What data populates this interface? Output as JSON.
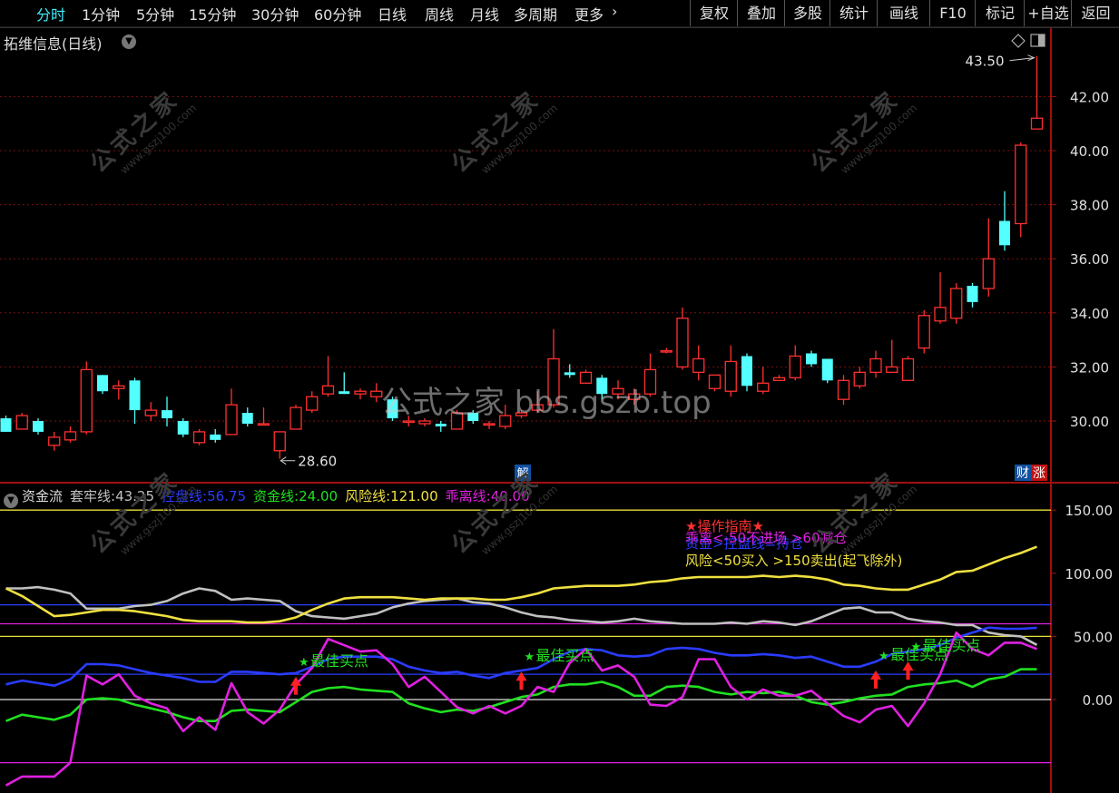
{
  "toolbar": {
    "periods": [
      "分时",
      "1分钟",
      "5分钟",
      "15分钟",
      "30分钟",
      "60分钟",
      "日线",
      "周线",
      "月线",
      "多周期",
      "更多"
    ],
    "active_period": "分时",
    "right_buttons": [
      "复权",
      "叠加",
      "多股",
      "统计",
      "画线",
      "F10",
      "标记",
      "+自选",
      "返回"
    ]
  },
  "stock": {
    "title": "拓维信息(日线)"
  },
  "watermark": {
    "center": "公式之家 bbs.gszb.top",
    "corner_cn": "公式之家",
    "corner_url": "www.gszj100.com"
  },
  "indicator": {
    "name": "资金流",
    "values": [
      {
        "label": "套牢线:",
        "value": "43.25",
        "color": "#c0c0c0"
      },
      {
        "label": "控盘线:",
        "value": "56.75",
        "color": "#2a3cff"
      },
      {
        "label": "资金线:",
        "value": "24.00",
        "color": "#20e020"
      },
      {
        "label": "风险线:",
        "value": "121.00",
        "color": "#f0e040"
      },
      {
        "label": "乖离线:",
        "value": "40.00",
        "color": "#e020e0"
      }
    ]
  },
  "annotations": {
    "guide_title": "★操作指南★",
    "guide_lines": [
      "乖离<-50不进场 >60减仓",
      "风险<50买入 >150卖出(起飞除外)"
    ],
    "guide_overlap": "资金>控盘线=持仓",
    "buy_label": "最佳买点",
    "max_label": "43.50",
    "min_label": "28.60",
    "badge_cw": "财",
    "badge_zhang": "涨",
    "badge_jie": "解"
  },
  "colors": {
    "up": "#ff3030",
    "down": "#54ffff",
    "grid": "#7a1010",
    "axis": "#a01010"
  },
  "chart_data": [
    {
      "type": "candlestick",
      "title": "拓维信息(日线)",
      "price_ticks": [
        "30.00",
        "32.00",
        "34.00",
        "36.00",
        "38.00",
        "40.00",
        "42.00"
      ],
      "ylim": [
        28.0,
        44.0
      ],
      "max_marker": 43.5,
      "min_marker": 28.6,
      "candles": [
        [
          30.1,
          29.6,
          30.2,
          29.6
        ],
        [
          29.7,
          30.2,
          30.3,
          29.7
        ],
        [
          30.0,
          29.6,
          30.1,
          29.5
        ],
        [
          29.1,
          29.4,
          29.6,
          28.9
        ],
        [
          29.3,
          29.6,
          29.8,
          29.2
        ],
        [
          29.6,
          31.9,
          32.2,
          29.5
        ],
        [
          31.7,
          31.1,
          31.7,
          31.0
        ],
        [
          31.2,
          31.3,
          31.5,
          30.8
        ],
        [
          31.5,
          30.4,
          31.6,
          29.9
        ],
        [
          30.2,
          30.4,
          30.7,
          30.0
        ],
        [
          30.4,
          30.1,
          30.9,
          29.8
        ],
        [
          30.0,
          29.5,
          30.1,
          29.4
        ],
        [
          29.2,
          29.6,
          29.7,
          29.1
        ],
        [
          29.5,
          29.3,
          29.7,
          29.2
        ],
        [
          29.5,
          30.6,
          31.2,
          29.5
        ],
        [
          30.3,
          29.9,
          30.5,
          29.8
        ],
        [
          29.9,
          29.9,
          30.5,
          29.9
        ],
        [
          28.9,
          29.6,
          29.6,
          28.6
        ],
        [
          29.7,
          30.5,
          30.6,
          29.7
        ],
        [
          30.4,
          30.9,
          31.1,
          30.3
        ],
        [
          31.0,
          31.3,
          32.4,
          30.9
        ],
        [
          31.1,
          31.0,
          31.8,
          31.0
        ],
        [
          31.0,
          31.1,
          31.2,
          30.8
        ],
        [
          30.9,
          31.1,
          31.4,
          30.7
        ],
        [
          30.8,
          30.1,
          30.9,
          30.0
        ],
        [
          30.0,
          30.0,
          30.2,
          29.8
        ],
        [
          29.9,
          30.0,
          30.1,
          29.8
        ],
        [
          29.9,
          29.8,
          30.0,
          29.6
        ],
        [
          29.7,
          30.3,
          30.4,
          29.7
        ],
        [
          30.3,
          30.0,
          30.4,
          29.9
        ],
        [
          29.9,
          29.9,
          30.0,
          29.7
        ],
        [
          29.8,
          30.2,
          30.6,
          29.7
        ],
        [
          30.2,
          30.3,
          30.4,
          30.1
        ],
        [
          30.4,
          30.6,
          31.1,
          30.3
        ],
        [
          30.6,
          32.3,
          33.4,
          30.5
        ],
        [
          31.8,
          31.7,
          32.1,
          31.6
        ],
        [
          31.4,
          31.8,
          31.9,
          31.4
        ],
        [
          31.6,
          31.0,
          31.7,
          30.8
        ],
        [
          31.0,
          31.2,
          31.5,
          30.8
        ],
        [
          30.8,
          31.0,
          31.2,
          30.6
        ],
        [
          31.0,
          31.9,
          32.5,
          30.9
        ],
        [
          32.6,
          32.6,
          32.7,
          32.5
        ],
        [
          32.0,
          33.8,
          34.2,
          31.9
        ],
        [
          31.8,
          32.3,
          32.8,
          31.5
        ],
        [
          31.2,
          31.7,
          31.7,
          31.1
        ],
        [
          31.1,
          32.2,
          32.8,
          30.9
        ],
        [
          32.4,
          31.3,
          32.5,
          31.1
        ],
        [
          31.1,
          31.4,
          32.0,
          31.0
        ],
        [
          31.5,
          31.6,
          31.7,
          31.5
        ],
        [
          31.6,
          32.4,
          32.8,
          31.5
        ],
        [
          32.5,
          32.1,
          32.6,
          32.0
        ],
        [
          32.3,
          31.5,
          32.3,
          31.4
        ],
        [
          30.8,
          31.5,
          31.7,
          30.6
        ],
        [
          31.3,
          31.8,
          32.0,
          31.2
        ],
        [
          31.8,
          32.3,
          32.6,
          31.6
        ],
        [
          31.8,
          32.0,
          33.0,
          31.8
        ],
        [
          31.5,
          32.3,
          32.4,
          31.5
        ],
        [
          32.7,
          33.9,
          34.1,
          32.5
        ],
        [
          33.7,
          34.2,
          35.5,
          33.6
        ],
        [
          33.8,
          34.9,
          35.1,
          33.6
        ],
        [
          35.0,
          34.4,
          35.1,
          34.2
        ],
        [
          34.9,
          36.0,
          37.5,
          34.6
        ],
        [
          37.4,
          36.5,
          38.5,
          36.3
        ],
        [
          37.3,
          40.2,
          40.3,
          36.8
        ],
        [
          40.8,
          41.2,
          43.5,
          40.9
        ]
      ]
    },
    {
      "type": "line",
      "title": "资金流",
      "yticks": [
        "0.00",
        "50.00",
        "100.00",
        "150.00"
      ],
      "ylim": [
        -72,
        168
      ],
      "hlines": [
        {
          "value": 150,
          "color": "#e8e03a"
        },
        {
          "value": 75,
          "color": "#2a3cff"
        },
        {
          "value": 60,
          "color": "#e020e0"
        },
        {
          "value": 50,
          "color": "#e8e03a"
        },
        {
          "value": 20,
          "color": "#2a3cff"
        },
        {
          "value": 0,
          "color": "#e0e0e0"
        },
        {
          "value": -50,
          "color": "#e020e0"
        }
      ],
      "series": [
        {
          "name": "套牢线",
          "color": "#c0c0c0",
          "values": [
            88,
            88,
            89,
            87,
            84,
            72,
            72,
            72,
            74,
            75,
            78,
            84,
            88,
            86,
            79,
            80,
            79,
            78,
            70,
            66,
            65,
            64,
            66,
            68,
            73,
            76,
            78,
            79,
            80,
            77,
            76,
            73,
            69,
            66,
            65,
            63,
            62,
            61,
            62,
            64,
            62,
            61,
            60,
            60,
            60,
            61,
            60,
            62,
            61,
            59,
            62,
            67,
            72,
            73,
            69,
            69,
            64,
            62,
            61,
            59,
            59,
            53,
            51,
            50,
            43.25
          ]
        },
        {
          "name": "控盘线",
          "color": "#2a3cff",
          "values": [
            12,
            15,
            13,
            11,
            16,
            28,
            28,
            27,
            24,
            21,
            19,
            17,
            14,
            14,
            22,
            22,
            21,
            20,
            21,
            26,
            32,
            34,
            34,
            34,
            32,
            26,
            23,
            21,
            22,
            19,
            17,
            21,
            23,
            25,
            32,
            38,
            40,
            39,
            35,
            34,
            35,
            40,
            41,
            40,
            37,
            35,
            35,
            36,
            35,
            33,
            34,
            30,
            26,
            26,
            30,
            36,
            38,
            40,
            43,
            49,
            53,
            57,
            56,
            56,
            56.75
          ]
        },
        {
          "name": "资金线",
          "color": "#20e020",
          "values": [
            -17,
            -12,
            -14,
            -16,
            -12,
            0,
            1,
            0,
            -4,
            -7,
            -10,
            -14,
            -17,
            -17,
            -9,
            -8,
            -9,
            -10,
            -2,
            6,
            9,
            10,
            8,
            7,
            6,
            -3,
            -7,
            -10,
            -8,
            -9,
            -6,
            -2,
            2,
            4,
            10,
            12,
            12,
            14,
            10,
            3,
            3,
            10,
            11,
            10,
            6,
            4,
            6,
            5,
            6,
            3,
            -2,
            -4,
            -2,
            1,
            3,
            4,
            10,
            12,
            13,
            15,
            10,
            16,
            18,
            24,
            24.0
          ]
        },
        {
          "name": "风险线",
          "color": "#f0e040",
          "values": [
            88,
            82,
            74,
            66,
            67,
            69,
            71,
            71,
            70,
            68,
            66,
            63,
            62,
            62,
            62,
            61,
            61,
            62,
            65,
            71,
            76,
            80,
            81,
            81,
            81,
            80,
            79,
            80,
            80,
            80,
            79,
            79,
            81,
            84,
            88,
            89,
            90,
            90,
            90,
            91,
            93,
            94,
            96,
            97,
            97,
            97,
            97,
            98,
            97,
            98,
            97,
            95,
            91,
            90,
            88,
            87,
            87,
            91,
            95,
            101,
            102,
            107,
            112,
            116,
            121.0
          ]
        },
        {
          "name": "乖离线",
          "color": "#e020e0",
          "values": [
            -68,
            -61,
            -61,
            -61,
            -50,
            19,
            12,
            20,
            3,
            -3,
            -7,
            -25,
            -14,
            -24,
            13,
            -10,
            -19,
            -8,
            12,
            25,
            48,
            43,
            38,
            39,
            28,
            10,
            18,
            6,
            -6,
            -11,
            -5,
            -11,
            -5,
            10,
            6,
            29,
            40,
            23,
            27,
            18,
            -4,
            -5,
            2,
            32,
            32,
            10,
            0,
            8,
            3,
            3,
            7,
            -3,
            -13,
            -18,
            -8,
            -5,
            -21,
            -3,
            20,
            53,
            40,
            35,
            45,
            45,
            40.0
          ]
        }
      ]
    }
  ]
}
